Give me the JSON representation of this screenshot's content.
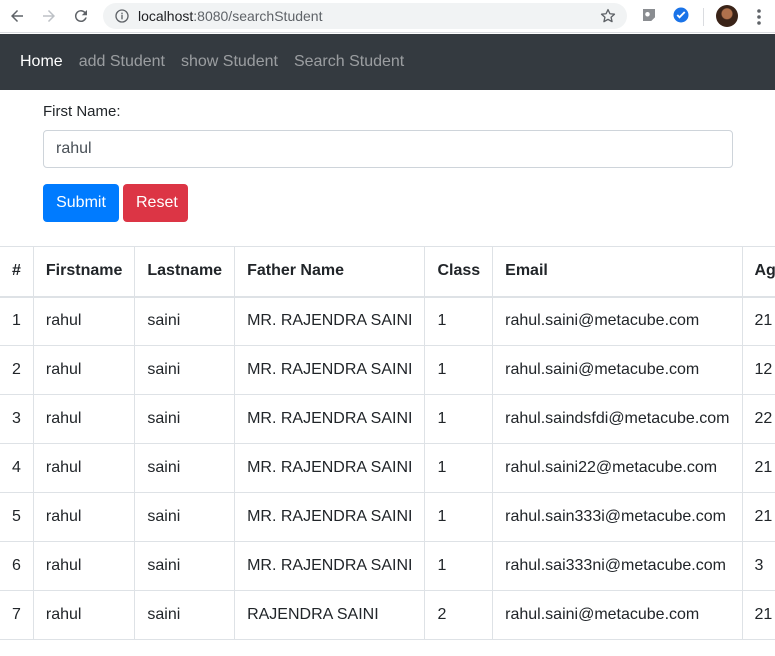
{
  "browser": {
    "url_host": "localhost",
    "url_rest": ":8080/searchStudent"
  },
  "navbar": {
    "items": [
      {
        "label": "Home",
        "active": true
      },
      {
        "label": "add Student",
        "active": false
      },
      {
        "label": "show Student",
        "active": false
      },
      {
        "label": "Search Student",
        "active": false
      }
    ]
  },
  "form": {
    "first_name_label": "First Name:",
    "first_name_value": "rahul",
    "submit_label": "Submit",
    "reset_label": "Reset"
  },
  "table": {
    "headers": [
      "#",
      "Firstname",
      "Lastname",
      "Father Name",
      "Class",
      "Email",
      "Age"
    ],
    "rows": [
      [
        "1",
        "rahul",
        "saini",
        "MR. RAJENDRA SAINI",
        "1",
        "rahul.saini@metacube.com",
        "21"
      ],
      [
        "2",
        "rahul",
        "saini",
        "MR. RAJENDRA SAINI",
        "1",
        "rahul.saini@metacube.com",
        "12"
      ],
      [
        "3",
        "rahul",
        "saini",
        "MR. RAJENDRA SAINI",
        "1",
        "rahul.saindsfdi@metacube.com",
        "22"
      ],
      [
        "4",
        "rahul",
        "saini",
        "MR. RAJENDRA SAINI",
        "1",
        "rahul.saini22@metacube.com",
        "21"
      ],
      [
        "5",
        "rahul",
        "saini",
        "MR. RAJENDRA SAINI",
        "1",
        "rahul.sain333i@metacube.com",
        "21"
      ],
      [
        "6",
        "rahul",
        "saini",
        "MR. RAJENDRA SAINI",
        "1",
        "rahul.sai333ni@metacube.com",
        "3"
      ],
      [
        "7",
        "rahul",
        "saini",
        "RAJENDRA SAINI",
        "2",
        "rahul.saini@metacube.com",
        "21"
      ]
    ]
  },
  "colors": {
    "navbar_bg": "#343a40",
    "submit": "#007bff",
    "reset": "#dc3545"
  },
  "icons": [
    "back-arrow-icon",
    "forward-arrow-icon",
    "reload-icon",
    "info-icon",
    "star-icon",
    "extension-icon",
    "extension-icon-blue",
    "avatar",
    "kebab-menu-icon"
  ]
}
